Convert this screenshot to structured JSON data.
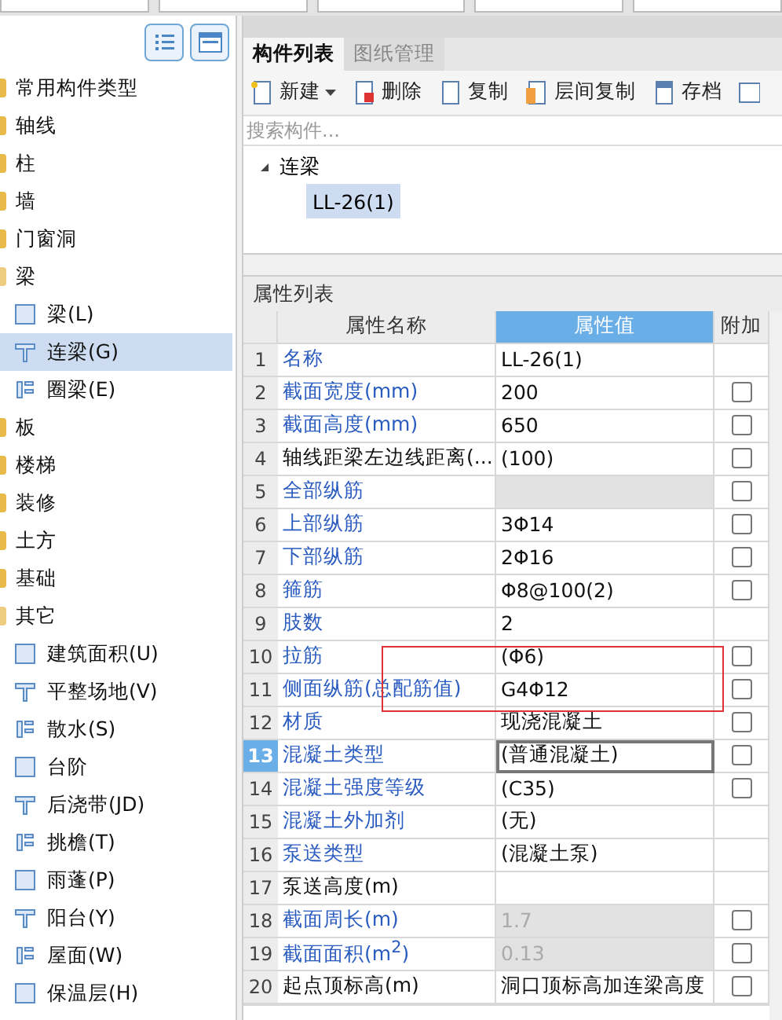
{
  "top_fields": [
    {
      "kind": "field"
    },
    {
      "kind": "field"
    },
    {
      "kind": "field"
    },
    {
      "kind": "field"
    },
    {
      "kind": "field"
    }
  ],
  "sidebar": {
    "items": [
      {
        "label": "常用构件类型",
        "expanded": false,
        "selected": false
      },
      {
        "label": "轴线",
        "expanded": false,
        "selected": false
      },
      {
        "label": "柱",
        "expanded": false,
        "selected": false
      },
      {
        "label": "墙",
        "expanded": false,
        "selected": false
      },
      {
        "label": "门窗洞",
        "expanded": false,
        "selected": false
      },
      {
        "label": "梁",
        "expanded": true,
        "selected": false,
        "children": [
          {
            "label": "梁(L)",
            "selected": false
          },
          {
            "label": "连梁(G)",
            "selected": true
          },
          {
            "label": "圈梁(E)",
            "selected": false
          }
        ]
      },
      {
        "label": "板",
        "expanded": false,
        "selected": false
      },
      {
        "label": "楼梯",
        "expanded": false,
        "selected": false
      },
      {
        "label": "装修",
        "expanded": false,
        "selected": false
      },
      {
        "label": "土方",
        "expanded": false,
        "selected": false
      },
      {
        "label": "基础",
        "expanded": false,
        "selected": false
      },
      {
        "label": "其它",
        "expanded": true,
        "selected": false,
        "children": [
          {
            "label": "建筑面积(U)",
            "selected": false
          },
          {
            "label": "平整场地(V)",
            "selected": false
          },
          {
            "label": "散水(S)",
            "selected": false
          },
          {
            "label": "台阶",
            "selected": false
          },
          {
            "label": "后浇带(JD)",
            "selected": false
          },
          {
            "label": "挑檐(T)",
            "selected": false
          },
          {
            "label": "雨蓬(P)",
            "selected": false
          },
          {
            "label": "阳台(Y)",
            "selected": false
          },
          {
            "label": "屋面(W)",
            "selected": false
          },
          {
            "label": "保温层(H)",
            "selected": false
          }
        ]
      }
    ]
  },
  "tabs": [
    {
      "label": "构件列表",
      "selected": true
    },
    {
      "label": "图纸管理",
      "selected": false
    }
  ],
  "toolbar": [
    {
      "label": "新建",
      "dropdown": true
    },
    {
      "label": "删除",
      "dropdown": false
    },
    {
      "label": "复制",
      "dropdown": false
    },
    {
      "label": "层间复制",
      "dropdown": false
    },
    {
      "label": "存档",
      "dropdown": false
    }
  ],
  "search": {
    "placeholder": "搜索构件..."
  },
  "component_tree": [
    {
      "label": "连梁",
      "expanded": true,
      "children": [
        {
          "label": "LL-26(1)",
          "selected": true
        }
      ]
    }
  ],
  "properties": {
    "title": "属性列表",
    "columns": [
      "属性名称",
      "属性值",
      "附加"
    ],
    "rows": [
      {
        "num": "1",
        "name": "名称",
        "value": "LL-26(1)",
        "common": true,
        "disabled": false,
        "selected": false
      },
      {
        "num": "2",
        "name": "截面宽度(mm)",
        "value": "200",
        "common": true,
        "checked": false,
        "disabled": false,
        "selected": false
      },
      {
        "num": "3",
        "name": "截面高度(mm)",
        "value": "650",
        "common": true,
        "checked": false,
        "disabled": false,
        "selected": false
      },
      {
        "num": "4",
        "name": "轴线距梁左边线距离(...",
        "value": "(100)",
        "common": false,
        "checked": false,
        "disabled": false,
        "selected": false
      },
      {
        "num": "5",
        "name": "全部纵筋",
        "common": true,
        "checked": false,
        "disabled": true,
        "selected": false
      },
      {
        "num": "6",
        "name": "上部纵筋",
        "value": "3Φ14",
        "common": true,
        "checked": false,
        "disabled": false,
        "selected": false
      },
      {
        "num": "7",
        "name": "下部纵筋",
        "value": "2Φ16",
        "common": true,
        "checked": false,
        "disabled": false,
        "selected": false
      },
      {
        "num": "8",
        "name": "箍筋",
        "value": "Φ8@100(2)",
        "common": true,
        "checked": false,
        "disabled": false,
        "selected": false
      },
      {
        "num": "9",
        "name": "肢数",
        "value": "2",
        "common": true,
        "disabled": false,
        "selected": false
      },
      {
        "num": "10",
        "name": "拉筋",
        "value": "(Φ6)",
        "common": true,
        "checked": false,
        "disabled": false,
        "selected": false
      },
      {
        "num": "11",
        "name": "侧面纵筋(总配筋值)",
        "value": "G4Φ12",
        "common": true,
        "checked": false,
        "disabled": false,
        "selected": false
      },
      {
        "num": "12",
        "name": "材质",
        "value": "现浇混凝土",
        "common": true,
        "checked": false,
        "disabled": false,
        "selected": false
      },
      {
        "num": "13",
        "name": "混凝土类型",
        "value": "(普通混凝土)",
        "common": true,
        "checked": false,
        "disabled": false,
        "selected": true
      },
      {
        "num": "14",
        "name": "混凝土强度等级",
        "value": "(C35)",
        "common": true,
        "checked": false,
        "disabled": false,
        "selected": false
      },
      {
        "num": "15",
        "name": "混凝土外加剂",
        "value": "(无)",
        "common": true,
        "disabled": false,
        "selected": false
      },
      {
        "num": "16",
        "name": "泵送类型",
        "value": "(混凝土泵)",
        "common": true,
        "disabled": false,
        "selected": false
      },
      {
        "num": "17",
        "name": "泵送高度(m)",
        "common": false,
        "disabled": false,
        "selected": false
      },
      {
        "num": "18",
        "name": "截面周长(m)",
        "value": "1.7",
        "common": true,
        "checked": false,
        "disabled": true,
        "selected": false
      },
      {
        "num": "19",
        "name": "截面面积(m$^{2}$)",
        "value": "0.13",
        "common": true,
        "checked": false,
        "disabled": true,
        "selected": false
      },
      {
        "num": "20",
        "name": "起点顶标高(m)",
        "value": "洞口顶标高加连梁高度",
        "common": false,
        "checked": false,
        "disabled": false,
        "selected": false
      }
    ]
  }
}
